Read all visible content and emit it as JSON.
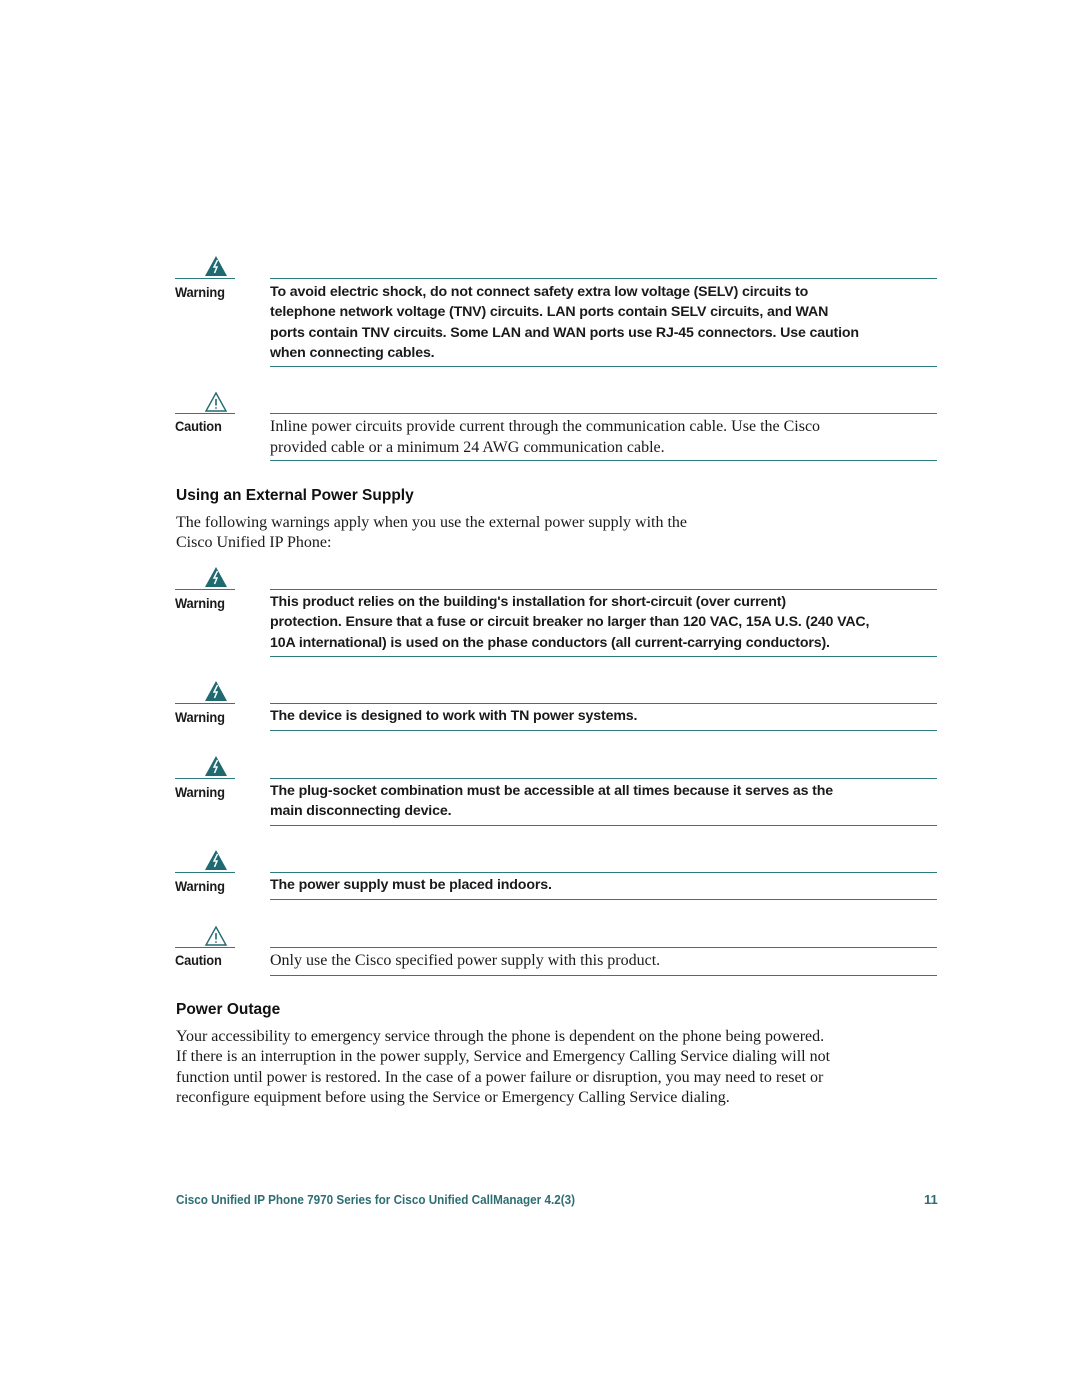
{
  "colors": {
    "accent": "#2d7a7f",
    "text": "#1a1a1a",
    "footer": "#2d6e73"
  },
  "notices": [
    {
      "type": "warning",
      "icon": "warning-lightning-icon",
      "label": "Warning",
      "lines": [
        "To avoid electric shock, do not connect safety extra low voltage (SELV) circuits to",
        "telephone network voltage (TNV) circuits. LAN ports contain SELV circuits, and WAN",
        "ports contain TNV circuits. Some LAN and WAN ports use RJ-45 connectors. Use caution",
        "when connecting cables."
      ]
    },
    {
      "type": "caution",
      "icon": "caution-exclamation-icon",
      "label": "Caution",
      "lines": [
        "Inline power circuits provide current through the communication cable. Use the Cisco",
        "provided cable or a minimum 24 AWG communication cable."
      ]
    },
    {
      "type": "warning",
      "icon": "warning-lightning-icon",
      "label": "Warning",
      "lines": [
        "This product relies on the building's installation for short-circuit (over current)",
        "protection. Ensure that a fuse or circuit breaker no larger than 120 VAC, 15A U.S. (240 VAC,",
        "10A international) is used on the phase conductors (all current-carrying conductors)."
      ]
    },
    {
      "type": "warning",
      "icon": "warning-lightning-icon",
      "label": "Warning",
      "lines": [
        "The device is designed to work with TN power systems."
      ]
    },
    {
      "type": "warning",
      "icon": "warning-lightning-icon",
      "label": "Warning",
      "lines": [
        "The plug-socket combination must be accessible at all times because it serves as the",
        "main disconnecting device."
      ]
    },
    {
      "type": "warning",
      "icon": "warning-lightning-icon",
      "label": "Warning",
      "lines": [
        "The power supply must be placed indoors."
      ]
    },
    {
      "type": "caution",
      "icon": "caution-exclamation-icon",
      "label": "Caution",
      "lines": [
        "Only use the Cisco specified power supply with this product."
      ]
    }
  ],
  "sections": {
    "external_power": {
      "heading": "Using an External Power Supply",
      "lines": [
        "The following warnings apply when you use the external power supply with the",
        "Cisco Unified IP Phone:"
      ]
    },
    "power_outage": {
      "heading": "Power Outage",
      "lines": [
        "Your accessibility to emergency service through the phone is dependent on the phone being powered.",
        "If there is an interruption in the power supply, Service and Emergency Calling Service dialing will not",
        "function until power is restored. In the case of a power failure or disruption, you may need to reset or",
        "reconfigure equipment before using the Service or Emergency Calling Service dialing."
      ]
    }
  },
  "footer": {
    "title": "Cisco Unified IP Phone 7970 Series for Cisco Unified CallManager 4.2(3)",
    "page_number": "11"
  }
}
